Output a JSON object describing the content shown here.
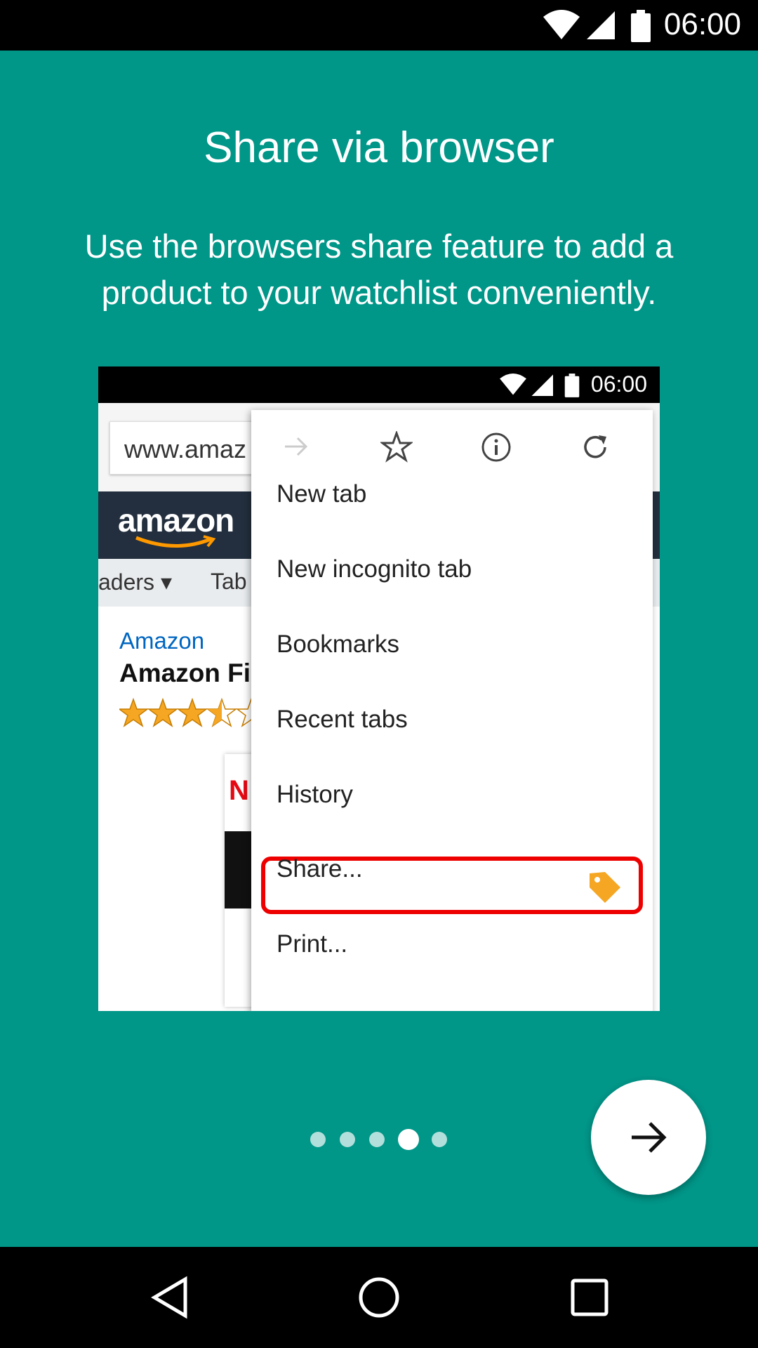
{
  "status_bar": {
    "time": "06:00"
  },
  "intro": {
    "title": "Share via browser",
    "description": "Use the browsers share feature to add a product to your watchlist conveniently."
  },
  "illustration": {
    "status_time": "06:00",
    "url_text": "www.amaz",
    "amazon_logo": "amazon",
    "subnav": [
      "aders ▾",
      "Tab"
    ],
    "brand": "Amazon",
    "product_name": "Amazon Fi",
    "menu": {
      "icons": [
        "forward-arrow-icon",
        "star-icon",
        "info-icon",
        "refresh-icon"
      ],
      "items": [
        "New tab",
        "New incognito tab",
        "Bookmarks",
        "Recent tabs",
        "History",
        "Share...",
        "Print..."
      ]
    }
  },
  "pager": {
    "count": 5,
    "active_index": 3
  },
  "colors": {
    "background": "#009688",
    "highlight": "#ee0000",
    "tag": "#f5a623"
  }
}
